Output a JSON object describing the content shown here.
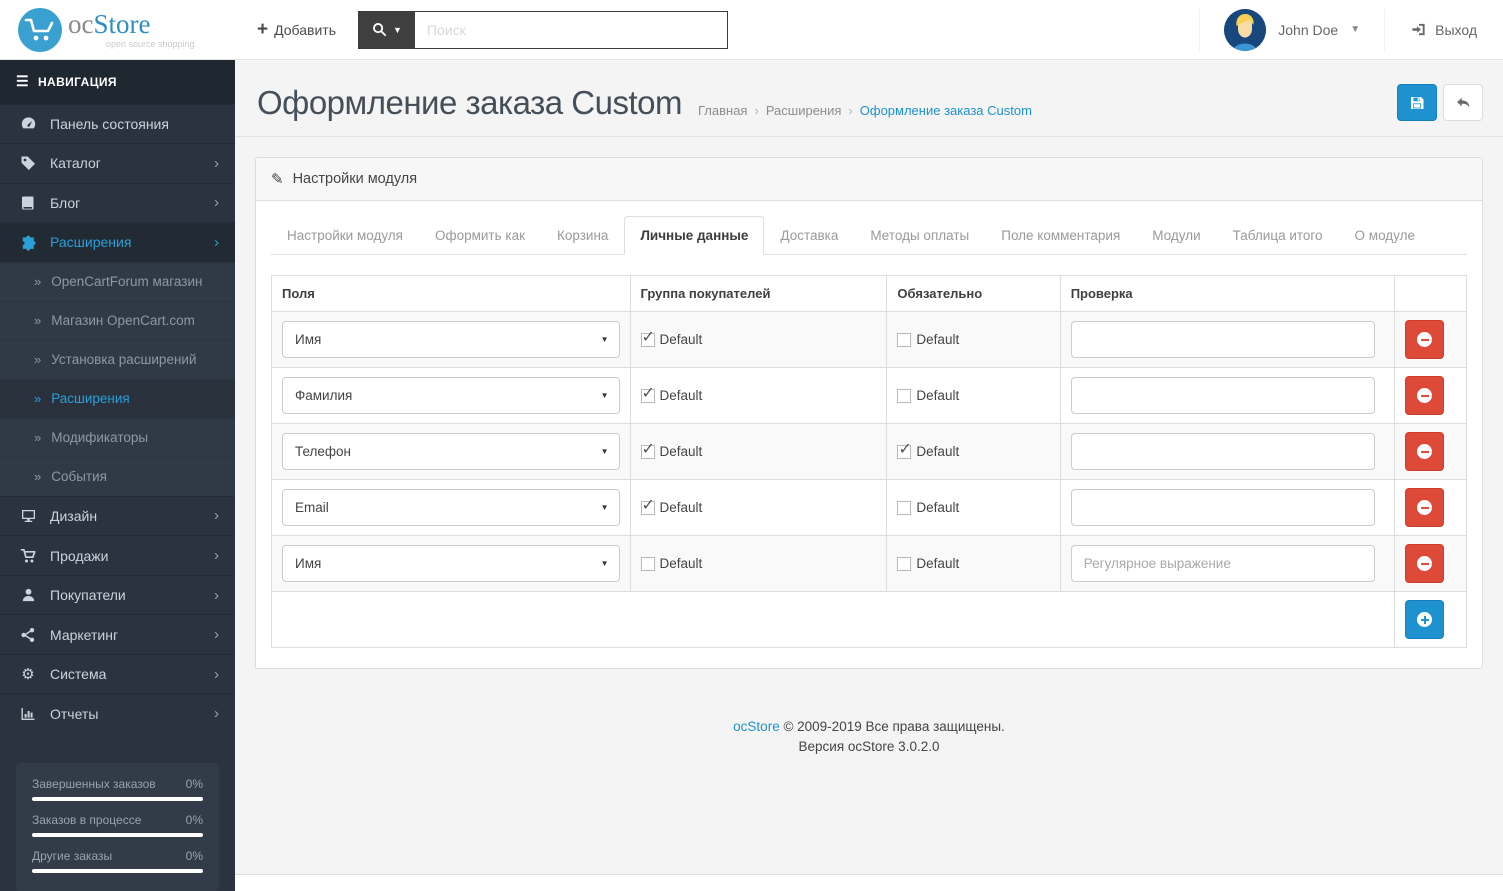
{
  "header": {
    "logo": {
      "oc": "oc",
      "store": "Store",
      "tagline": "open source shopping"
    },
    "add_label": "Добавить",
    "search_placeholder": "Поиск",
    "user_name": "John Doe",
    "logout_label": "Выход"
  },
  "sidebar": {
    "nav_title": "НАВИГАЦИЯ",
    "items": [
      {
        "label": "Панель состояния"
      },
      {
        "label": "Каталог"
      },
      {
        "label": "Блог"
      },
      {
        "label": "Расширения"
      },
      {
        "label": "Дизайн"
      },
      {
        "label": "Продажи"
      },
      {
        "label": "Покупатели"
      },
      {
        "label": "Маркетинг"
      },
      {
        "label": "Система"
      },
      {
        "label": "Отчеты"
      }
    ],
    "extensions_submenu": [
      {
        "label": "OpenCartForum магазин"
      },
      {
        "label": "Магазин OpenCart.com"
      },
      {
        "label": "Установка расширений"
      },
      {
        "label": "Расширения"
      },
      {
        "label": "Модификаторы"
      },
      {
        "label": "События"
      }
    ],
    "stats": [
      {
        "label": "Завершенных заказов",
        "value": "0%"
      },
      {
        "label": "Заказов в процессе",
        "value": "0%"
      },
      {
        "label": "Другие заказы",
        "value": "0%"
      }
    ]
  },
  "page": {
    "title": "Оформление заказа Custom",
    "breadcrumb": [
      {
        "label": "Главная"
      },
      {
        "label": "Расширения"
      },
      {
        "label": "Оформление заказа Custom"
      }
    ]
  },
  "panel": {
    "heading": "Настройки модуля",
    "tabs": [
      "Настройки модуля",
      "Оформить как",
      "Корзина",
      "Личные данные",
      "Доставка",
      "Методы оплаты",
      "Поле комментария",
      "Модули",
      "Таблица итого",
      "О модуле"
    ],
    "active_tab": "Личные данные"
  },
  "table": {
    "headers": {
      "field": "Поля",
      "group": "Группа покупателей",
      "required": "Обязательно",
      "validation": "Проверка"
    },
    "checkbox_label": "Default",
    "rows": [
      {
        "field": "Имя",
        "group_checked": true,
        "required_checked": false,
        "validation_value": "",
        "validation_placeholder": ""
      },
      {
        "field": "Фамилия",
        "group_checked": true,
        "required_checked": false,
        "validation_value": "",
        "validation_placeholder": ""
      },
      {
        "field": "Телефон",
        "group_checked": true,
        "required_checked": true,
        "validation_value": "",
        "validation_placeholder": ""
      },
      {
        "field": "Email",
        "group_checked": true,
        "required_checked": false,
        "validation_value": "",
        "validation_placeholder": ""
      },
      {
        "field": "Имя",
        "group_checked": false,
        "required_checked": false,
        "validation_value": "",
        "validation_placeholder": "Регулярное выражение"
      }
    ]
  },
  "footer": {
    "brand": "ocStore",
    "copyright": " © 2009-2019 Все права защищены.",
    "version": "Версия ocStore 3.0.2.0"
  },
  "colors": {
    "accent": "#1e91cf",
    "danger": "#dd4a38",
    "sidebar_bg": "#2b3340",
    "active_link": "#2a9fd8"
  }
}
